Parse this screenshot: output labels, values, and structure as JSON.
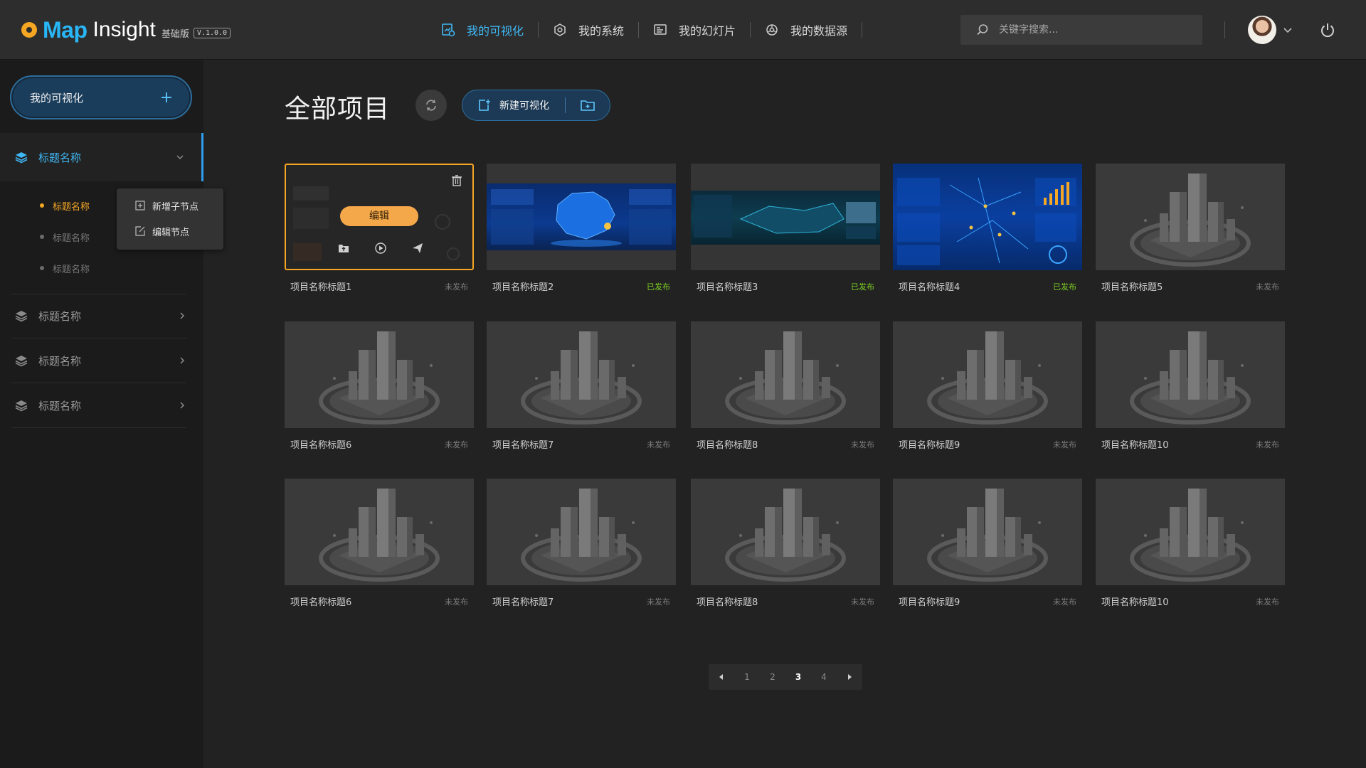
{
  "brand": {
    "logo": "Map",
    "name": "Insight",
    "edition": "基础版",
    "version": "V.1.0.0"
  },
  "nav": [
    {
      "label": "我的可视化",
      "icon": "visualization-icon",
      "active": true
    },
    {
      "label": "我的系统",
      "icon": "system-icon",
      "active": false
    },
    {
      "label": "我的幻灯片",
      "icon": "slides-icon",
      "active": false
    },
    {
      "label": "我的数据源",
      "icon": "datasource-icon",
      "active": false
    }
  ],
  "search": {
    "placeholder": "关键字搜索..."
  },
  "colors": {
    "accent": "#3fb8f5",
    "highlight": "#f5a623",
    "published": "#7ed321"
  },
  "sidebar": {
    "main_button": "我的可视化",
    "main_button_icon": "+",
    "groups": [
      {
        "label": "标题名称",
        "expanded": true,
        "children": [
          {
            "label": "标题名称",
            "active": true
          },
          {
            "label": "标题名称",
            "active": false
          },
          {
            "label": "标题名称",
            "active": false
          }
        ]
      },
      {
        "label": "标题名称",
        "expanded": false
      },
      {
        "label": "标题名称",
        "expanded": false
      },
      {
        "label": "标题名称",
        "expanded": false
      }
    ],
    "context_menu": [
      {
        "label": "新增子节点",
        "icon": "add-node-icon"
      },
      {
        "label": "编辑节点",
        "icon": "edit-node-icon"
      }
    ]
  },
  "main": {
    "title": "全部项目",
    "new_button": "新建可视化",
    "edit_label": "编辑",
    "cards": [
      {
        "name": "项目名称标题1",
        "status": "未发布"
      },
      {
        "name": "项目名称标题2",
        "status": "已发布"
      },
      {
        "name": "项目名称标题3",
        "status": "已发布"
      },
      {
        "name": "项目名称标题4",
        "status": "已发布"
      },
      {
        "name": "项目名称标题5",
        "status": "未发布"
      },
      {
        "name": "项目名称标题6",
        "status": "未发布"
      },
      {
        "name": "项目名称标题7",
        "status": "未发布"
      },
      {
        "name": "项目名称标题8",
        "status": "未发布"
      },
      {
        "name": "项目名称标题9",
        "status": "未发布"
      },
      {
        "name": "项目名称标题10",
        "status": "未发布"
      },
      {
        "name": "项目名称标题6",
        "status": "未发布"
      },
      {
        "name": "项目名称标题7",
        "status": "未发布"
      },
      {
        "name": "项目名称标题8",
        "status": "未发布"
      },
      {
        "name": "项目名称标题9",
        "status": "未发布"
      },
      {
        "name": "项目名称标题10",
        "status": "未发布"
      }
    ]
  },
  "pagination": {
    "pages": [
      "1",
      "2",
      "3",
      "4"
    ],
    "current": "3"
  }
}
